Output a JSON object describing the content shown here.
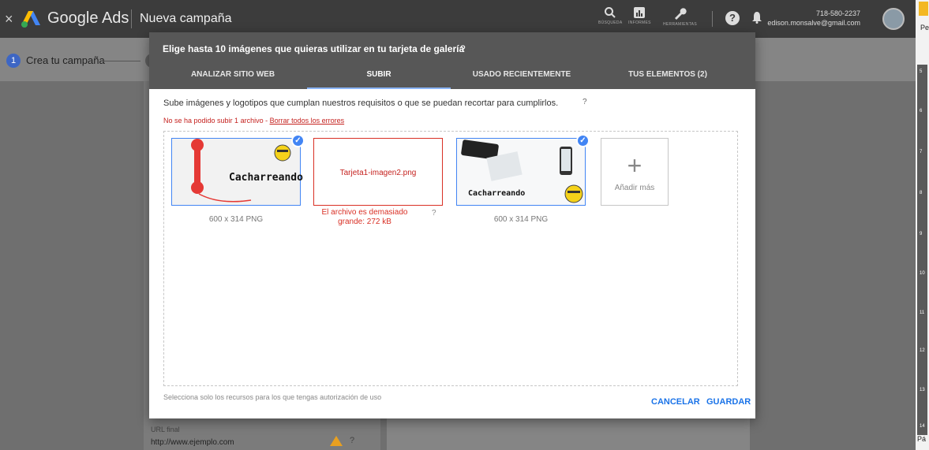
{
  "topbar": {
    "close_glyph": "×",
    "brand": "Google Ads",
    "campaign": "Nueva campaña",
    "tools": [
      {
        "name": "search-icon",
        "label": "BÚSQUEDA"
      },
      {
        "name": "reports-icon",
        "label": "INFORMES"
      },
      {
        "name": "tools-icon",
        "label": "HERRAMIENTAS"
      }
    ],
    "help_glyph": "?",
    "phone": "718-580-2237",
    "email": "edison.monsalve@gmail.com"
  },
  "right_strip": {
    "top_text": "Pe",
    "bottom_text": "Pá",
    "ruler_numbers": [
      "5",
      "6",
      "7",
      "8",
      "9",
      "10",
      "11",
      "12",
      "13",
      "14"
    ]
  },
  "stepper": {
    "step_number": "1",
    "step_label": "Crea tu campaña"
  },
  "background": {
    "url_label": "URL final",
    "url_value": "http://www.ejemplo.com",
    "help_glyph": "?"
  },
  "dialog": {
    "title": "Elige hasta 10 imágenes que quieras utilizar en tu tarjeta de galería",
    "title_help": "?",
    "tabs": [
      {
        "label": "ANALIZAR SITIO WEB",
        "active": false
      },
      {
        "label": "SUBIR",
        "active": true
      },
      {
        "label": "USADO RECIENTEMENTE",
        "active": false
      },
      {
        "label": "TUS ELEMENTOS (2)",
        "active": false
      }
    ],
    "instructions": "Sube imágenes y logotipos que cumplan nuestros requisitos o que se puedan recortar para cumplirlos.",
    "instructions_help": "?",
    "error_text": "No se ha podido subir 1 archivo - ",
    "error_link": "Borrar todos los errores",
    "images": [
      {
        "caption": "600 x 314 PNG",
        "watermark": "Cacharreando",
        "selected": true,
        "check": "✓"
      },
      {
        "filename": "Tarjeta1-imagen2.png",
        "error": "El archivo es demasiado grande: 272 kB",
        "help": "?"
      },
      {
        "caption": "600 x 314 PNG",
        "watermark": "Cacharreando",
        "selected": true,
        "check": "✓"
      }
    ],
    "add_more_glyph": "+",
    "add_more_label": "Añadir más",
    "footer_note": "Selecciona solo los recursos para los que tengas autorización de uso",
    "cancel_label": "CANCELAR",
    "save_label": "GUARDAR"
  },
  "colors": {
    "accent": "#1a73e8",
    "error": "#d93025",
    "check": "#4285f4",
    "header": "#575757",
    "topbar": "#3c3c3c"
  }
}
